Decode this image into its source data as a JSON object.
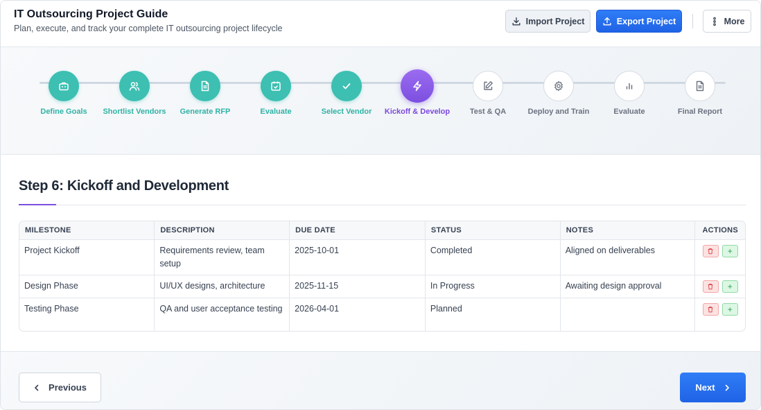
{
  "header": {
    "title": "IT Outsourcing Project Guide",
    "subtitle": "Plan, execute, and track your complete IT outsourcing project lifecycle",
    "import_label": "Import Project",
    "export_label": "Export Project",
    "more_label": "More"
  },
  "stepper": {
    "current_step": 6,
    "steps": [
      {
        "label": "Define Goals",
        "status": "done",
        "icon": "briefcase-icon"
      },
      {
        "label": "Shortlist Vendors",
        "status": "done",
        "icon": "users-icon"
      },
      {
        "label": "Generate RFP",
        "status": "done",
        "icon": "document-icon"
      },
      {
        "label": "Evaluate",
        "status": "done",
        "icon": "clipboard-check-icon"
      },
      {
        "label": "Select Vendor",
        "status": "done",
        "icon": "check-icon"
      },
      {
        "label": "Kickoff & Develop",
        "status": "current",
        "icon": "lightning-icon"
      },
      {
        "label": "Test & QA",
        "status": "todo",
        "icon": "edit-icon"
      },
      {
        "label": "Deploy and Train",
        "status": "todo",
        "icon": "gear-icon"
      },
      {
        "label": "Evaluate",
        "status": "todo",
        "icon": "bar-chart-icon"
      },
      {
        "label": "Final Report",
        "status": "todo",
        "icon": "report-icon"
      }
    ]
  },
  "main": {
    "title": "Step 6: Kickoff and Development"
  },
  "table": {
    "headers": {
      "milestone": "MILESTONE",
      "description": "DESCRIPTION",
      "due_date": "DUE DATE",
      "status": "STATUS",
      "notes": "NOTES",
      "actions": "ACTIONS"
    },
    "rows": [
      {
        "milestone": "Project Kickoff",
        "description": "Requirements review, team setup",
        "due_date": "2025-10-01",
        "status": "Completed",
        "notes": "Aligned on deliverables"
      },
      {
        "milestone": "Design Phase",
        "description": "UI/UX designs, architecture",
        "due_date": "2025-11-15",
        "status": "In Progress",
        "notes": "Awaiting design approval"
      },
      {
        "milestone": "Testing Phase",
        "description": "QA and user acceptance testing",
        "due_date": "2026-04-01",
        "status": "Planned",
        "notes": ""
      }
    ],
    "add_symbol": "+"
  },
  "footer": {
    "previous_label": "Previous",
    "next_label": "Next"
  },
  "colors": {
    "accent_blue": "#1f63e6",
    "done_teal": "#3dbfb2",
    "current_purple": "#7c4fe0",
    "delete_red": "#dc4a4a",
    "add_green": "#2e9e55"
  }
}
